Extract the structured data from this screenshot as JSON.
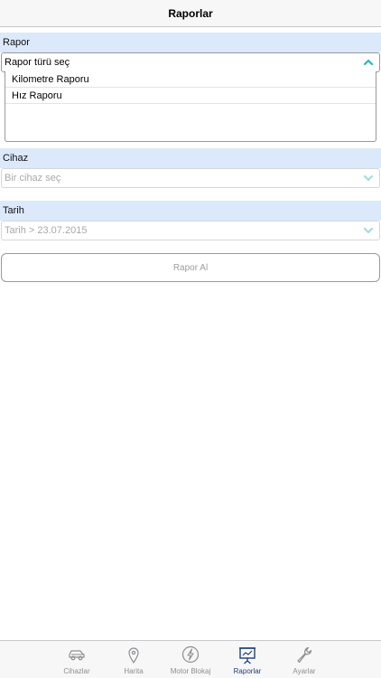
{
  "nav": {
    "title": "Raporlar"
  },
  "rapor": {
    "header": "Rapor",
    "select_value": "Rapor türü seç",
    "options": [
      "Kilometre Raporu",
      "Hız Raporu"
    ]
  },
  "cihaz": {
    "header": "Cihaz",
    "placeholder": "Bir cihaz seç"
  },
  "tarih": {
    "header": "Tarih",
    "placeholder": "Tarih > 23.07.2015"
  },
  "action": {
    "label": "Rapor Al"
  },
  "tabs": [
    {
      "label": "Cihazlar",
      "icon": "car-icon"
    },
    {
      "label": "Harita",
      "icon": "map-pin-icon"
    },
    {
      "label": "Motor Blokaj",
      "icon": "lightning-icon"
    },
    {
      "label": "Raporlar",
      "icon": "presentation-board-icon",
      "active": true
    },
    {
      "label": "Ayarlar",
      "icon": "wrench-icon"
    }
  ],
  "colors": {
    "accent": "#2bb5b5",
    "section_bg": "#dbe9fa",
    "tab_active": "#1f3f77",
    "tab_inactive": "#8e8e93"
  }
}
